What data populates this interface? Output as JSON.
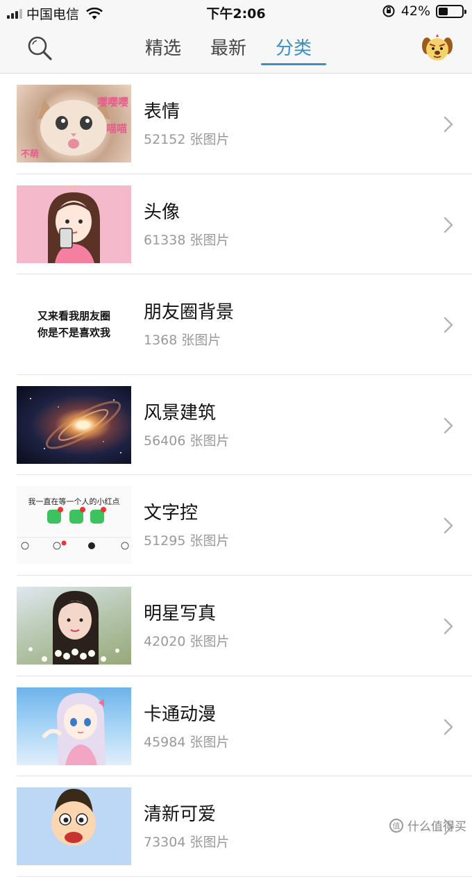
{
  "status_bar": {
    "carrier": "中国电信",
    "time": "下午2:06",
    "battery_percent_text": "42%",
    "battery_level": 0.42
  },
  "header": {
    "search_icon": "search-icon",
    "tabs": [
      {
        "label": "精选",
        "active": false
      },
      {
        "label": "最新",
        "active": false
      },
      {
        "label": "分类",
        "active": true
      }
    ],
    "accent_color": "#3a8fc4"
  },
  "categories": [
    {
      "title": "表情",
      "count": "52152 张图片",
      "thumb_text": [
        "嘤嘤嘤",
        "喵喵",
        "不萌"
      ]
    },
    {
      "title": "头像",
      "count": "61338 张图片"
    },
    {
      "title": "朋友圈背景",
      "count": "1368 张图片",
      "thumb_text": [
        "又来看我朋友圈",
        "你是不是喜欢我"
      ]
    },
    {
      "title": "风景建筑",
      "count": "56406 张图片"
    },
    {
      "title": "文字控",
      "count": "51295 张图片",
      "thumb_text": [
        "我一直在等一个人的小红点"
      ]
    },
    {
      "title": "明星写真",
      "count": "42020 张图片"
    },
    {
      "title": "卡通动漫",
      "count": "45984 张图片"
    },
    {
      "title": "清新可爱",
      "count": "73304 张图片"
    }
  ],
  "watermark": {
    "text": "什么值得买",
    "badge": "值"
  }
}
